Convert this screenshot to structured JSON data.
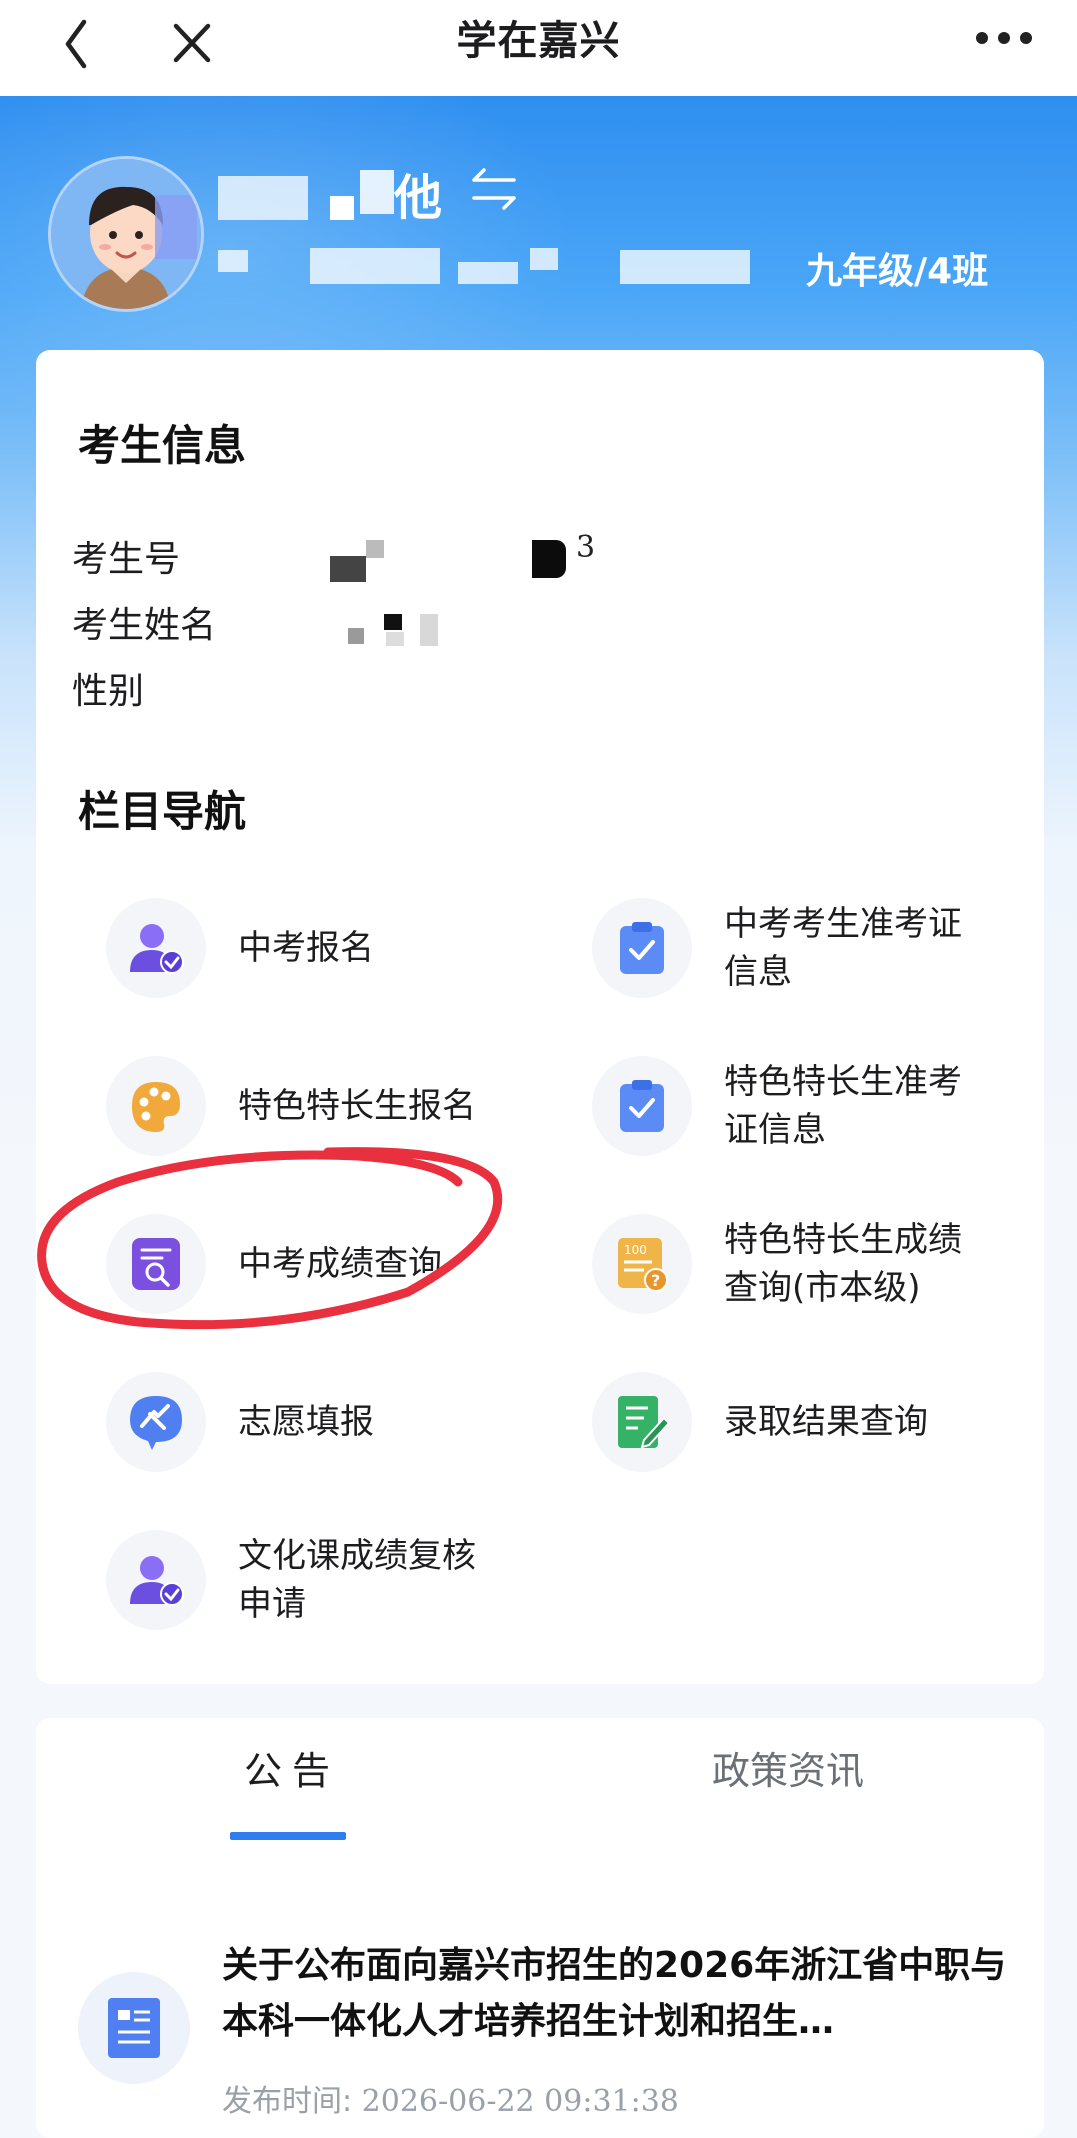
{
  "nav": {
    "title": "学在嘉兴",
    "back_icon": "chevron-left-icon",
    "close_icon": "close-icon",
    "more_icon": "more-horizontal-icon"
  },
  "profile": {
    "name_visible": "他",
    "grade_class": "九年级/4班",
    "switch_icon": "switch-arrows-icon"
  },
  "exam_info": {
    "title": "考生信息",
    "fields": [
      {
        "label": "考生号",
        "value": "3"
      },
      {
        "label": "考生姓名",
        "value": ""
      },
      {
        "label": "性别",
        "value": ""
      }
    ]
  },
  "column_nav": {
    "title": "栏目导航",
    "items": [
      {
        "label": "中考报名",
        "icon": "user-check-icon"
      },
      {
        "label": "中考考生准考证信息",
        "icon": "clipboard-check-icon"
      },
      {
        "label": "特色特长生报名",
        "icon": "palette-icon"
      },
      {
        "label": "特色特长生准考证信息",
        "icon": "clipboard-check-icon"
      },
      {
        "label": "中考成绩查询",
        "icon": "document-search-icon"
      },
      {
        "label": "特色特长生成绩查询(市本级)",
        "icon": "score-question-icon"
      },
      {
        "label": "志愿填报",
        "icon": "wish-chat-icon"
      },
      {
        "label": "录取结果查询",
        "icon": "edit-document-icon"
      },
      {
        "label": "文化课成绩复核申请",
        "icon": "user-check-icon"
      }
    ]
  },
  "notices": {
    "tabs": [
      {
        "label": "公告",
        "active": true
      },
      {
        "label": "政策资讯",
        "active": false
      }
    ],
    "items": [
      {
        "title": "关于公布面向嘉兴市招生的2026年浙江省中职与本科一体化人才培养招生计划和招生…",
        "time_label": "发布时间:",
        "time": "2026-06-22 09:31:38",
        "icon": "news-list-icon"
      }
    ]
  },
  "colors": {
    "header_blue": "#2f8ff0",
    "accent_blue": "#2d7ff0",
    "purple_icon": "#7b5cf0",
    "highlight_red": "#e8303f"
  }
}
